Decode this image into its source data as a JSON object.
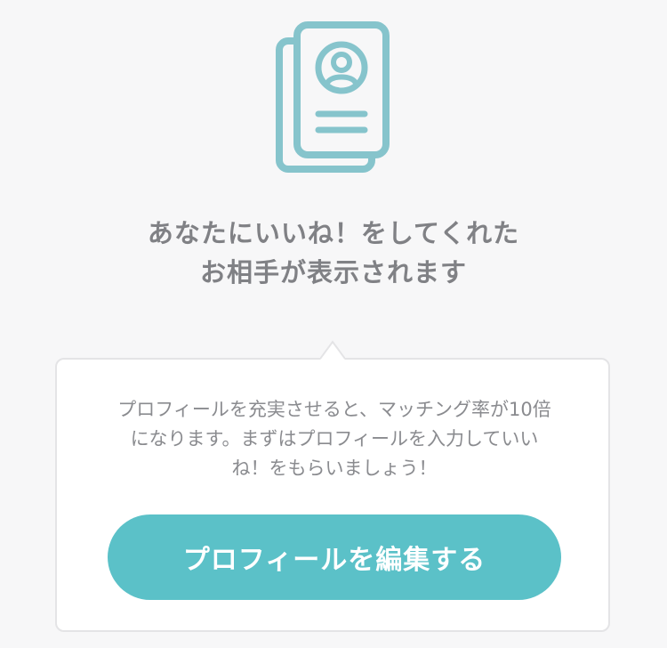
{
  "empty_state": {
    "icon": "profile-card-icon",
    "headline_line1": "あなたにいいね！をしてくれた",
    "headline_line2": "お相手が表示されます"
  },
  "tip_card": {
    "body_line1": "プロフィールを充実させると、マッチング率が10倍",
    "body_line2": "になります。まずはプロフィールを入力していい",
    "body_line3": "ね！をもらいましょう！",
    "button_label": "プロフィールを編集する"
  },
  "colors": {
    "accent": "#5bc1c8",
    "icon": "#86c4cc",
    "text": "#808185",
    "background": "#f7f7f8"
  }
}
